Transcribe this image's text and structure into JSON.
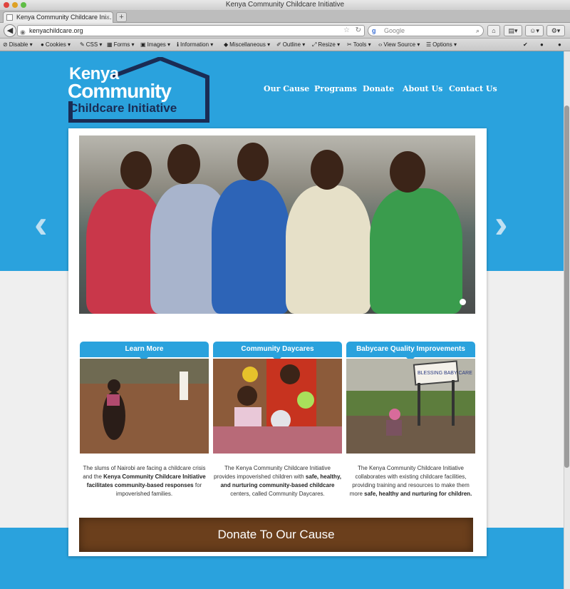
{
  "window": {
    "title": "Kenya Community Childcare Initiative",
    "tab_label": "Kenya Community Childcare Ini...",
    "new_tab_label": "+"
  },
  "navbar": {
    "url": "kenyachildcare.org",
    "search_placeholder": "Google",
    "search_engine_glyph": "g"
  },
  "devbar": {
    "items": [
      "Disable",
      "Cookies",
      "CSS",
      "Forms",
      "Images",
      "Information",
      "Miscellaneous",
      "Outline",
      "Resize",
      "Tools",
      "View Source",
      "Options"
    ]
  },
  "site": {
    "logo": {
      "line1": "Kenya",
      "line2": "Community",
      "line3": "Childcare Initiative"
    },
    "nav": [
      "Our Cause",
      "Programs",
      "Donate",
      "About Us",
      "Contact Us"
    ],
    "boxes": [
      {
        "title": "Learn More"
      },
      {
        "title": "Community Daycares"
      },
      {
        "title": "Babycare Quality Improvements"
      }
    ],
    "desc1": {
      "a": "The slums of Nairobi are facing a childcare crisis and the ",
      "b": "Kenya Community Childcare Initiative facilitates community-based responses",
      "c": " for impoverished families."
    },
    "desc2": {
      "a": "The Kenya Community Childcare Initiative provides impoverished children with ",
      "b": "safe, healthy, and nurturing community-based childcare",
      "c": " centers, called Community Daycares."
    },
    "desc3": {
      "a": "The Kenya Community Childcare Initiative collaborates with existing childcare facilities, providing training and resources to make them more ",
      "b": "safe, healthy and nurturing for children.",
      "c": ""
    },
    "donate_cta": "Donate To Our Cause",
    "sign_text": "BLESSING BABY CARE"
  },
  "colors": {
    "brand_blue": "#2aa2dd",
    "logo_navy": "#1a2c54",
    "donate_brown": "#6b3f1c"
  }
}
